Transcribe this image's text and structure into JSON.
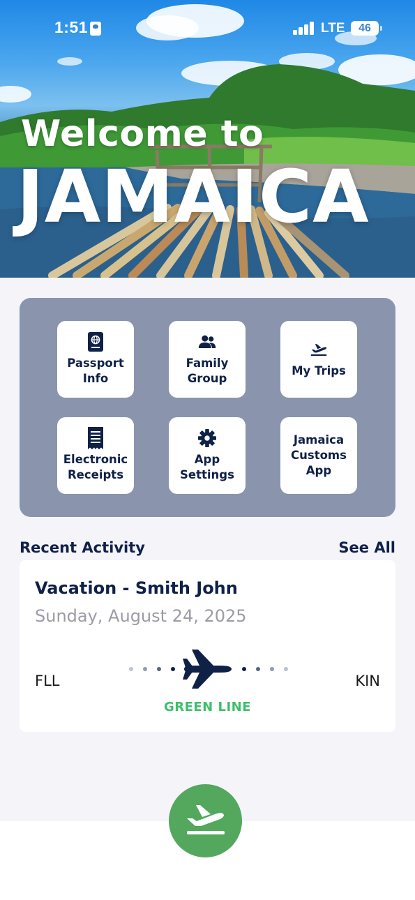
{
  "status_bar": {
    "time": "1:51",
    "network": "LTE",
    "battery": "46"
  },
  "hero": {
    "line1": "Welcome to",
    "line2": "JAMAICA"
  },
  "menu": {
    "tiles": [
      {
        "label_line1": "Passport",
        "label_line2": "Info",
        "icon": "passport-icon"
      },
      {
        "label_line1": "Family",
        "label_line2": "Group",
        "icon": "users-icon"
      },
      {
        "label_line1": "My Trips",
        "label_line2": "",
        "icon": "plane-departure-icon"
      },
      {
        "label_line1": "Electronic",
        "label_line2": "Receipts",
        "icon": "receipt-icon"
      },
      {
        "label_line1": "App",
        "label_line2": "Settings",
        "icon": "gear-icon"
      },
      {
        "label_line1": "Jamaica",
        "label_line2": "Customs",
        "label_line3": "App",
        "icon": ""
      }
    ]
  },
  "recent": {
    "title": "Recent Activity",
    "see_all": "See All",
    "card": {
      "trip_title": "Vacation - Smith John",
      "date": "Sunday, August 24, 2025",
      "from": "FLL",
      "to": "KIN",
      "line": "GREEN LINE"
    }
  },
  "colors": {
    "navy": "#0f2147",
    "panel": "#8a95ad",
    "green_line": "#3cbf6a",
    "fab": "#53a85e"
  },
  "fab": {
    "icon": "plane-departure-icon"
  }
}
